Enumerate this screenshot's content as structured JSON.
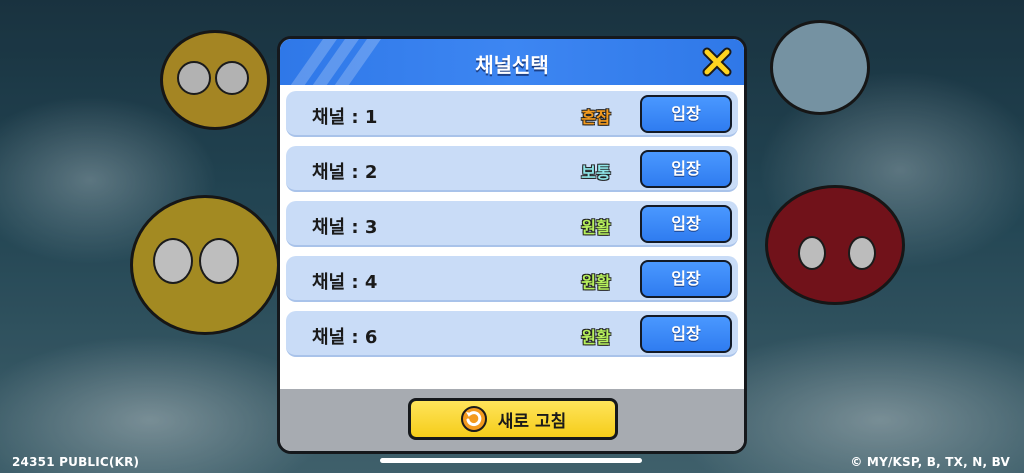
{
  "dialog": {
    "title": "채널선택",
    "close_icon": "close-x-icon",
    "enter_label": "입장",
    "refresh_label": "새로 고침",
    "refresh_icon": "refresh-arrow-icon"
  },
  "channels": [
    {
      "name": "채널 : 1",
      "status": "혼잡",
      "status_color": "#f39a1e"
    },
    {
      "name": "채널 : 2",
      "status": "보통",
      "status_color": "#8fe6e8"
    },
    {
      "name": "채널 : 3",
      "status": "원활",
      "status_color": "#b7f05c"
    },
    {
      "name": "채널 : 4",
      "status": "원활",
      "status_color": "#b7f05c"
    },
    {
      "name": "채널 : 6",
      "status": "원활",
      "status_color": "#b7f05c"
    }
  ],
  "footer": {
    "left": "24351 PUBLIC(KR)",
    "right": "© MY/KSP, B, TX, N, BV"
  },
  "colors": {
    "header_blue": "#3d86f2",
    "row_bg": "#c9dcf7",
    "button_blue": "#2f7cf0",
    "refresh_yellow": "#f5cd1a"
  }
}
